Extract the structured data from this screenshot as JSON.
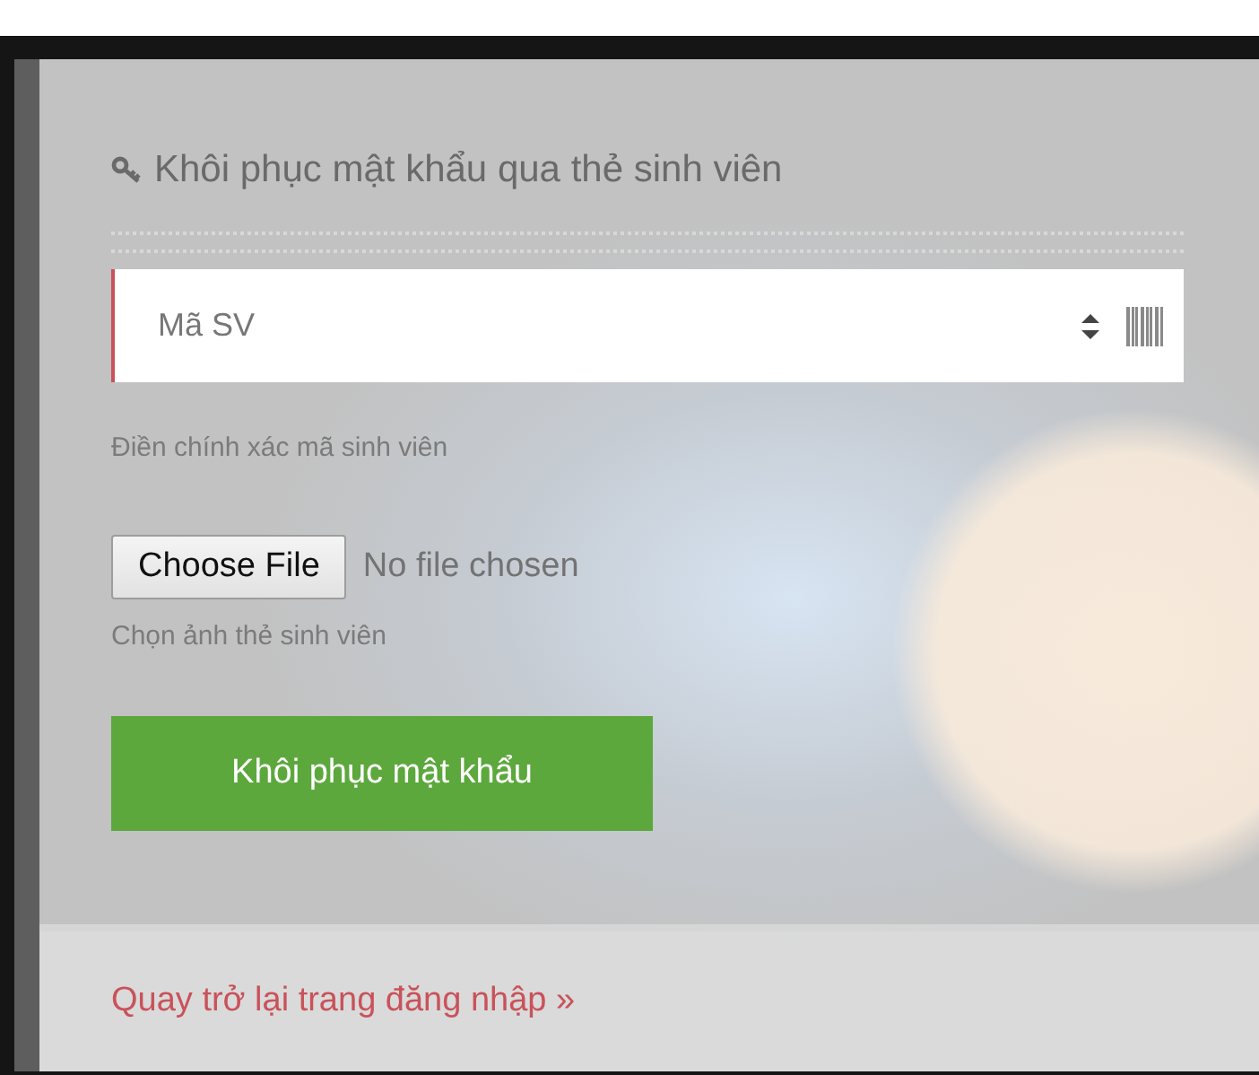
{
  "title": "Khôi phục mật khẩu qua thẻ sinh viên",
  "student_id": {
    "placeholder": "Mã SV",
    "hint": "Điền chính xác mã sinh viên"
  },
  "file_input": {
    "button": "Choose File",
    "status": "No file chosen",
    "hint": "Chọn ảnh thẻ sinh viên"
  },
  "submit_button": "Khôi phục mật khẩu",
  "back_link": "Quay trở lại trang đăng nhập »"
}
